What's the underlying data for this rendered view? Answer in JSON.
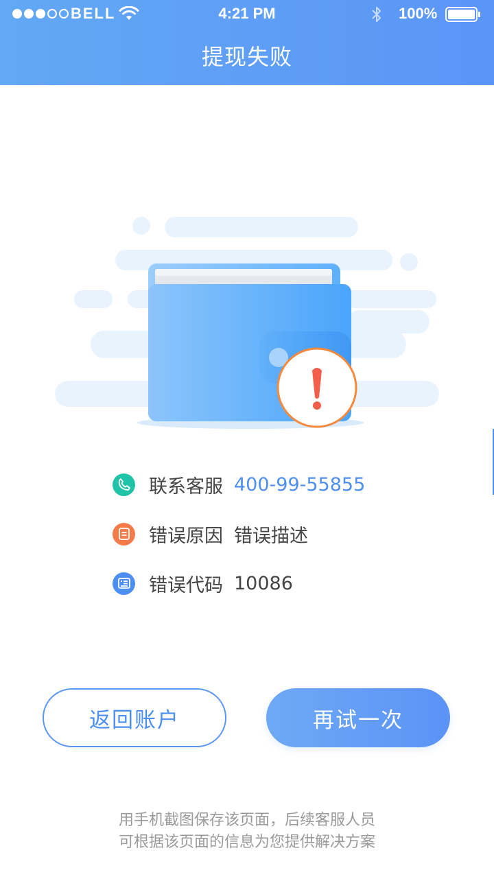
{
  "status_bar": {
    "carrier": "BELL",
    "time": "4:21 PM",
    "battery": "100%",
    "signal_icon": "signal-dots-icon",
    "wifi_icon": "wifi-icon",
    "bluetooth_icon": "bluetooth-icon",
    "battery_icon": "battery-icon"
  },
  "header": {
    "title": "提现失败"
  },
  "illustration": {
    "icon": "wallet-error-icon",
    "alert_mark": "!"
  },
  "info": {
    "contact": {
      "icon": "phone-icon",
      "label": "联系客服",
      "value": "400-99-55855",
      "color": "#20c3a8"
    },
    "reason": {
      "icon": "document-icon",
      "label": "错误原因",
      "value": "错误描述",
      "color": "#f57c4a"
    },
    "code": {
      "icon": "id-card-icon",
      "label": "错误代码",
      "value": "10086",
      "color": "#4c8ff0"
    }
  },
  "buttons": {
    "back": "返回账户",
    "retry": "再试一次"
  },
  "footer": {
    "line1": "用手机截图保存该页面，后续客服人员",
    "line2": "可根据该页面的信息为您提供解决方案"
  },
  "colors": {
    "accent": "#4c8ff0",
    "header_start": "#62a8f4",
    "header_end": "#5b95f7",
    "alert": "#f46a4a"
  }
}
